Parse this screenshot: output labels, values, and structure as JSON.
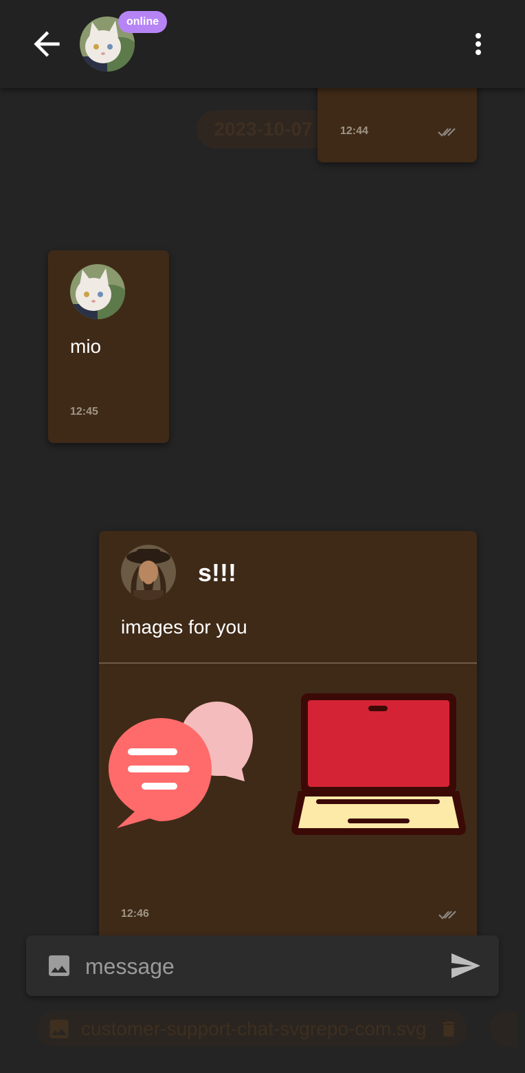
{
  "header": {
    "status_badge": "online",
    "back_icon": "arrow-left-icon",
    "more_icon": "more-vert-icon"
  },
  "date_divider": "2023-10-07",
  "messages": [
    {
      "time": "12:44",
      "status_icon": "double-check-icon"
    },
    {
      "text": "mio",
      "time": "12:45"
    },
    {
      "sender": "s!!!",
      "text": "images for you",
      "time": "12:46",
      "status_icon": "double-check-icon",
      "images": [
        "chat-bubbles-image",
        "laptop-image"
      ]
    }
  ],
  "composer": {
    "placeholder": "message",
    "image_icon": "image-icon",
    "send_icon": "send-icon"
  },
  "attachments": [
    {
      "name": "customer-support-chat-svgrepo-com.svg",
      "icon": "image-icon",
      "remove_icon": "delete-icon"
    }
  ],
  "colors": {
    "background": "#242424",
    "appbar": "#222222",
    "bubble": "#3f2a18",
    "online_badge": "#b784f5",
    "composer": "#2c2c2c"
  }
}
